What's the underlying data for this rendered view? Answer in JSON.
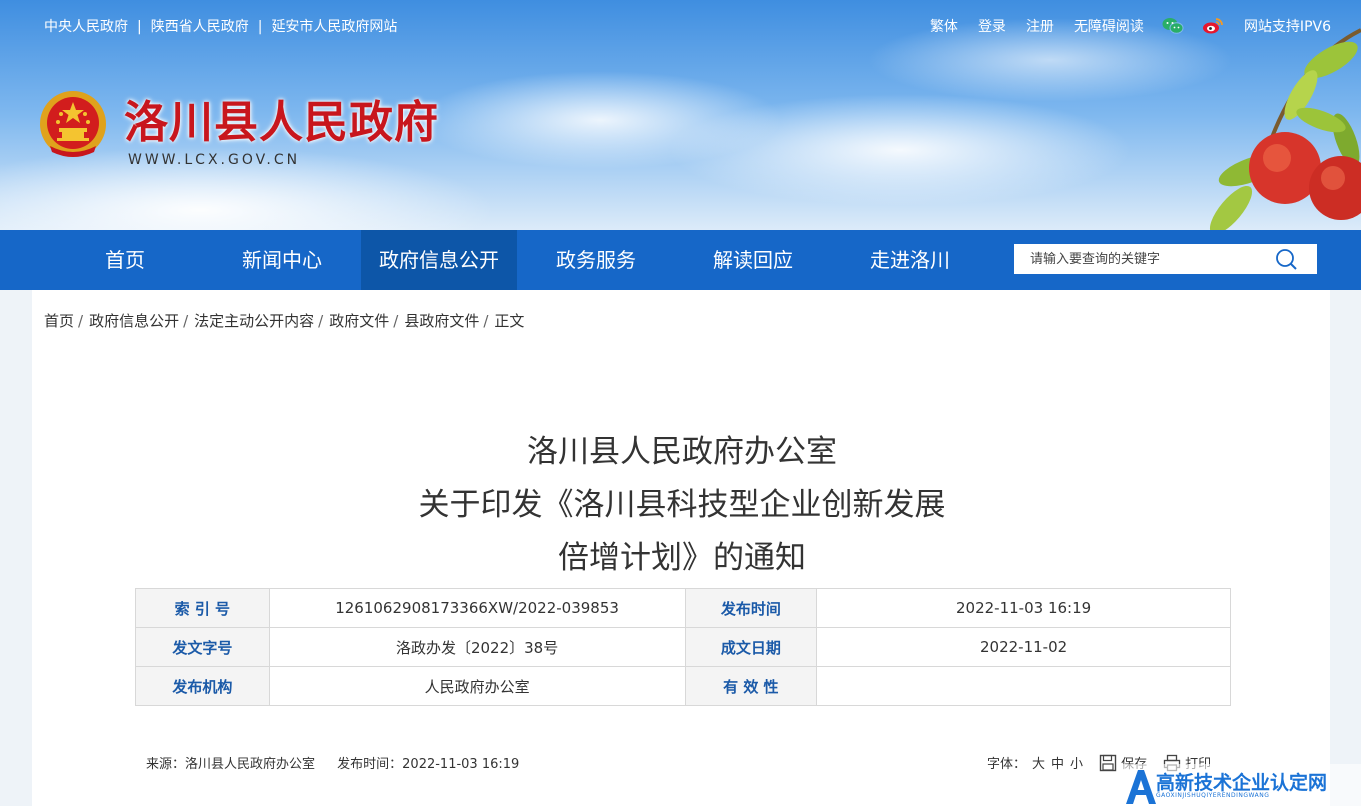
{
  "topbar": {
    "links": [
      "中央人民政府",
      "陕西省人民政府",
      "延安市人民政府网站"
    ],
    "separator": "|",
    "right": {
      "traditional": "繁体",
      "login": "登录",
      "register": "注册",
      "accessible": "无障碍阅读",
      "ipv6": "网站支持IPV6"
    }
  },
  "header": {
    "title": "洛川县人民政府",
    "url": "WWW.LCX.GOV.CN"
  },
  "nav": {
    "items": [
      "首页",
      "新闻中心",
      "政府信息公开",
      "政务服务",
      "解读回应",
      "走进洛川"
    ],
    "active_index": 2
  },
  "search": {
    "placeholder": "请输入要查询的关键字"
  },
  "breadcrumb": [
    "首页",
    "政府信息公开",
    "法定主动公开内容",
    "政府文件",
    "县政府文件",
    "正文"
  ],
  "breadcrumb_sep": "/",
  "article": {
    "title_lines": [
      "洛川县人民政府办公室",
      "关于印发《洛川县科技型企业创新发展",
      "倍增计划》的通知"
    ]
  },
  "meta": {
    "index_label": "索 引 号",
    "index_value": "1261062908173366XW/2022-039853",
    "publish_time_label": "发布时间",
    "publish_time_value": "2022-11-03 16:19",
    "doc_no_label": "发文字号",
    "doc_no_value": "洛政办发〔2022〕38号",
    "created_label": "成文日期",
    "created_value": "2022-11-02",
    "org_label": "发布机构",
    "org_value": "人民政府办公室",
    "validity_label": "有 效 性",
    "validity_value": ""
  },
  "footer_info": {
    "source": "来源：洛川县人民政府办公室",
    "time": "发布时间：2022-11-03 16:19",
    "font_label": "字体：",
    "sizes": [
      "大",
      "中",
      "小"
    ],
    "save": "保存",
    "print": "打印"
  },
  "watermark": {
    "text": "高新技术企业认定网",
    "sub": "GAOXINJISHUQIYERENDINGWANG"
  },
  "colors": {
    "nav_bg": "#1667c8",
    "nav_active": "#0d56a8",
    "title_red": "#c8161d",
    "label_blue": "#1b5aa8"
  }
}
